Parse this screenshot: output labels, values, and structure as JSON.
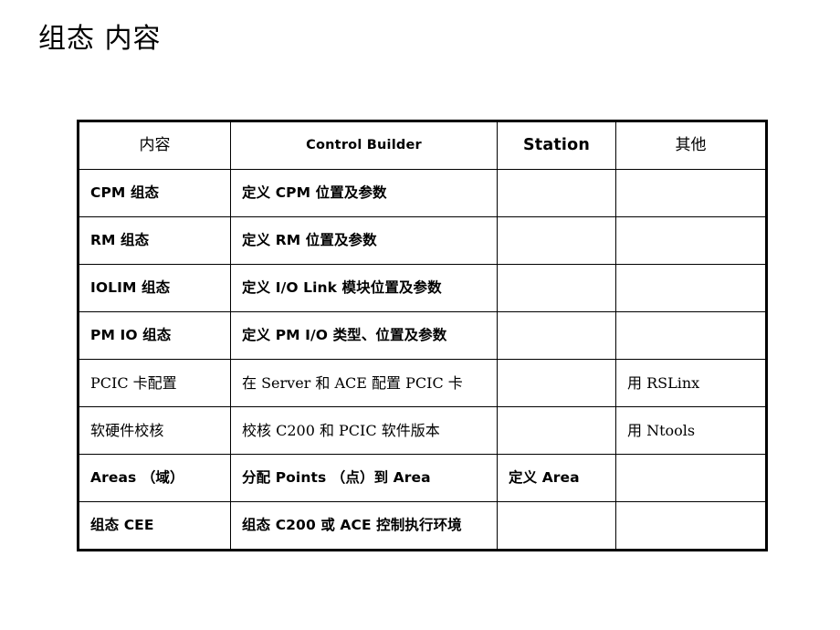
{
  "slide": {
    "title": "组态 内容",
    "background_color": "#ffffff",
    "text_color": "#000000",
    "border_color": "#000000"
  },
  "table": {
    "columns": [
      {
        "label": "内容",
        "style": "serif"
      },
      {
        "label": "Control Builder",
        "style": "bold"
      },
      {
        "label": "Station",
        "style": "bold-large"
      },
      {
        "label": "其他",
        "style": "serif"
      }
    ],
    "rows": [
      {
        "content": "CPM 组态",
        "control_builder": "定义 CPM 位置及参数",
        "station": "",
        "other": ""
      },
      {
        "content": "RM 组态",
        "control_builder": "定义 RM 位置及参数",
        "station": "",
        "other": ""
      },
      {
        "content": "IOLIM 组态",
        "control_builder": "定义 I/O Link 模块位置及参数",
        "station": "",
        "other": ""
      },
      {
        "content": "PM IO 组态",
        "control_builder": "定义 PM I/O 类型、位置及参数",
        "station": "",
        "other": ""
      },
      {
        "content": "PCIC 卡配置",
        "control_builder": "在 Server 和 ACE 配置 PCIC 卡",
        "station": "",
        "other": "用 RSLinx"
      },
      {
        "content": "软硬件校核",
        "control_builder": "校核 C200 和 PCIC 软件版本",
        "station": "",
        "other": "用 Ntools"
      },
      {
        "content": "Areas （域）",
        "control_builder": "分配 Points （点）到 Area",
        "station": "定义 Area",
        "other": ""
      },
      {
        "content": "组态 CEE",
        "control_builder": "组态 C200 或 ACE 控制执行环境",
        "station": "",
        "other": ""
      }
    ]
  }
}
